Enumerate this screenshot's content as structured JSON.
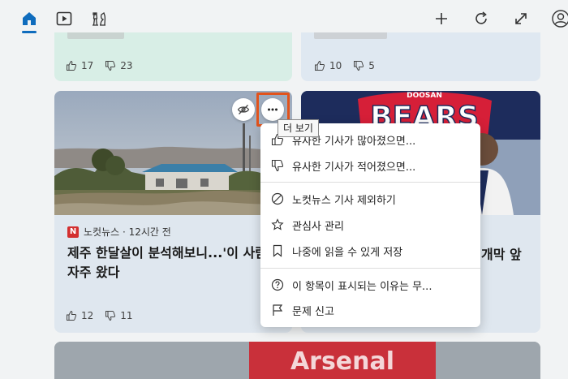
{
  "topbar": {
    "icons": [
      "home-icon",
      "video-icon",
      "chess-icon",
      "add-icon",
      "refresh-icon",
      "expand-icon",
      "profile-icon"
    ]
  },
  "cards": {
    "top_left": {
      "likes": "17",
      "dislikes": "23"
    },
    "top_right": {
      "likes": "10",
      "dislikes": "5"
    },
    "main": {
      "source": "노컷뉴스 · 12시간 전",
      "source_logo": "N",
      "headline": "제주 한달살이 분석해보니...'이 사람'이 자주 왔다",
      "likes": "12",
      "dislikes": "11"
    },
    "right": {
      "brand_small": "DOOSAN",
      "brand_big": "BEARS",
      "headline_fragment": "개막 앞"
    },
    "bottom": {
      "brand": "Arsenal"
    }
  },
  "tooltip": "더 보기",
  "menu": {
    "items": [
      {
        "label": "유사한 기사가 많아졌으면...",
        "icon": "thumbs-up-icon"
      },
      {
        "label": "유사한 기사가 적어졌으면...",
        "icon": "thumbs-down-icon"
      },
      {
        "label": "노컷뉴스 기사 제외하기",
        "icon": "block-icon"
      },
      {
        "label": "관심사 관리",
        "icon": "star-icon"
      },
      {
        "label": "나중에 읽을 수 있게 저장",
        "icon": "bookmark-icon"
      },
      {
        "label": "이 항목이 표시되는 이유는 무...",
        "icon": "help-icon"
      },
      {
        "label": "문제 신고",
        "icon": "flag-icon"
      }
    ]
  }
}
